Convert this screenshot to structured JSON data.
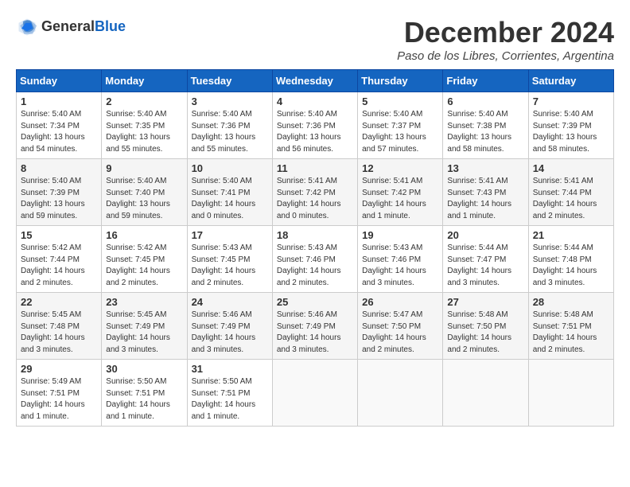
{
  "logo": {
    "text_general": "General",
    "text_blue": "Blue"
  },
  "header": {
    "month_year": "December 2024",
    "location": "Paso de los Libres, Corrientes, Argentina"
  },
  "weekdays": [
    "Sunday",
    "Monday",
    "Tuesday",
    "Wednesday",
    "Thursday",
    "Friday",
    "Saturday"
  ],
  "weeks": [
    [
      {
        "day": "1",
        "sunrise": "5:40 AM",
        "sunset": "7:34 PM",
        "daylight": "13 hours and 54 minutes."
      },
      {
        "day": "2",
        "sunrise": "5:40 AM",
        "sunset": "7:35 PM",
        "daylight": "13 hours and 55 minutes."
      },
      {
        "day": "3",
        "sunrise": "5:40 AM",
        "sunset": "7:36 PM",
        "daylight": "13 hours and 55 minutes."
      },
      {
        "day": "4",
        "sunrise": "5:40 AM",
        "sunset": "7:36 PM",
        "daylight": "13 hours and 56 minutes."
      },
      {
        "day": "5",
        "sunrise": "5:40 AM",
        "sunset": "7:37 PM",
        "daylight": "13 hours and 57 minutes."
      },
      {
        "day": "6",
        "sunrise": "5:40 AM",
        "sunset": "7:38 PM",
        "daylight": "13 hours and 58 minutes."
      },
      {
        "day": "7",
        "sunrise": "5:40 AM",
        "sunset": "7:39 PM",
        "daylight": "13 hours and 58 minutes."
      }
    ],
    [
      {
        "day": "8",
        "sunrise": "5:40 AM",
        "sunset": "7:39 PM",
        "daylight": "13 hours and 59 minutes."
      },
      {
        "day": "9",
        "sunrise": "5:40 AM",
        "sunset": "7:40 PM",
        "daylight": "13 hours and 59 minutes."
      },
      {
        "day": "10",
        "sunrise": "5:40 AM",
        "sunset": "7:41 PM",
        "daylight": "14 hours and 0 minutes."
      },
      {
        "day": "11",
        "sunrise": "5:41 AM",
        "sunset": "7:42 PM",
        "daylight": "14 hours and 0 minutes."
      },
      {
        "day": "12",
        "sunrise": "5:41 AM",
        "sunset": "7:42 PM",
        "daylight": "14 hours and 1 minute."
      },
      {
        "day": "13",
        "sunrise": "5:41 AM",
        "sunset": "7:43 PM",
        "daylight": "14 hours and 1 minute."
      },
      {
        "day": "14",
        "sunrise": "5:41 AM",
        "sunset": "7:44 PM",
        "daylight": "14 hours and 2 minutes."
      }
    ],
    [
      {
        "day": "15",
        "sunrise": "5:42 AM",
        "sunset": "7:44 PM",
        "daylight": "14 hours and 2 minutes."
      },
      {
        "day": "16",
        "sunrise": "5:42 AM",
        "sunset": "7:45 PM",
        "daylight": "14 hours and 2 minutes."
      },
      {
        "day": "17",
        "sunrise": "5:43 AM",
        "sunset": "7:45 PM",
        "daylight": "14 hours and 2 minutes."
      },
      {
        "day": "18",
        "sunrise": "5:43 AM",
        "sunset": "7:46 PM",
        "daylight": "14 hours and 2 minutes."
      },
      {
        "day": "19",
        "sunrise": "5:43 AM",
        "sunset": "7:46 PM",
        "daylight": "14 hours and 3 minutes."
      },
      {
        "day": "20",
        "sunrise": "5:44 AM",
        "sunset": "7:47 PM",
        "daylight": "14 hours and 3 minutes."
      },
      {
        "day": "21",
        "sunrise": "5:44 AM",
        "sunset": "7:48 PM",
        "daylight": "14 hours and 3 minutes."
      }
    ],
    [
      {
        "day": "22",
        "sunrise": "5:45 AM",
        "sunset": "7:48 PM",
        "daylight": "14 hours and 3 minutes."
      },
      {
        "day": "23",
        "sunrise": "5:45 AM",
        "sunset": "7:49 PM",
        "daylight": "14 hours and 3 minutes."
      },
      {
        "day": "24",
        "sunrise": "5:46 AM",
        "sunset": "7:49 PM",
        "daylight": "14 hours and 3 minutes."
      },
      {
        "day": "25",
        "sunrise": "5:46 AM",
        "sunset": "7:49 PM",
        "daylight": "14 hours and 3 minutes."
      },
      {
        "day": "26",
        "sunrise": "5:47 AM",
        "sunset": "7:50 PM",
        "daylight": "14 hours and 2 minutes."
      },
      {
        "day": "27",
        "sunrise": "5:48 AM",
        "sunset": "7:50 PM",
        "daylight": "14 hours and 2 minutes."
      },
      {
        "day": "28",
        "sunrise": "5:48 AM",
        "sunset": "7:51 PM",
        "daylight": "14 hours and 2 minutes."
      }
    ],
    [
      {
        "day": "29",
        "sunrise": "5:49 AM",
        "sunset": "7:51 PM",
        "daylight": "14 hours and 1 minute."
      },
      {
        "day": "30",
        "sunrise": "5:50 AM",
        "sunset": "7:51 PM",
        "daylight": "14 hours and 1 minute."
      },
      {
        "day": "31",
        "sunrise": "5:50 AM",
        "sunset": "7:51 PM",
        "daylight": "14 hours and 1 minute."
      },
      null,
      null,
      null,
      null
    ]
  ],
  "labels": {
    "sunrise_prefix": "Sunrise: ",
    "sunset_prefix": "Sunset: ",
    "daylight_prefix": "Daylight: "
  }
}
